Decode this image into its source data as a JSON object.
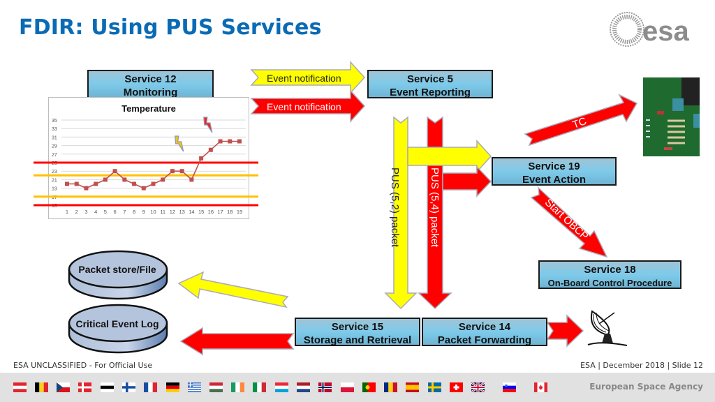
{
  "header": {
    "title": "FDIR: Using PUS Services",
    "logo_text": "esa"
  },
  "services": {
    "s12": {
      "line1": "Service 12",
      "line2": "Monitoring"
    },
    "s5": {
      "line1": "Service 5",
      "line2": "Event Reporting"
    },
    "s19": {
      "line1": "Service 19",
      "line2": "Event Action"
    },
    "s18": {
      "line1": "Service 18",
      "line2": "On-Board Control Procedure"
    },
    "s15": {
      "line1": "Service 15",
      "line2": "Storage and Retrieval"
    },
    "s14": {
      "line1": "Service 14",
      "line2": "Packet Forwarding"
    }
  },
  "arrows": {
    "event_notification_yellow": "Event notification",
    "event_notification_red": "Event notification",
    "pus_52": "PUS (5,2) packet",
    "pus_54": "PUS (5,4) packet",
    "tc": "TC",
    "start_obcp": "Start OBCP"
  },
  "stores": {
    "packet_store": "Packet store/File",
    "critical_log": "Critical Event Log"
  },
  "colors": {
    "yellow": "#ffff00",
    "red": "#ff0000",
    "title_blue": "#0a6bb5"
  },
  "chart_data": {
    "type": "line",
    "title": "Temperature",
    "x": [
      1,
      2,
      3,
      4,
      5,
      6,
      7,
      8,
      9,
      10,
      11,
      12,
      13,
      14,
      15,
      16,
      17,
      18,
      19
    ],
    "series": [
      {
        "name": "Temperature",
        "values": [
          20,
          20,
          19,
          20,
          21,
          23,
          21,
          20,
          19,
          20,
          21,
          23,
          23,
          21,
          26,
          28,
          30,
          30,
          30
        ],
        "color": "#c0504d"
      }
    ],
    "yticks": [
      15,
      17,
      19,
      21,
      23,
      25,
      27,
      29,
      31,
      33,
      35
    ],
    "ylim": [
      15,
      35
    ],
    "thresholds": [
      {
        "value": 25,
        "color": "#ff0000",
        "kind": "upper-alarm"
      },
      {
        "value": 22,
        "color": "#ffc000",
        "kind": "upper-warning"
      },
      {
        "value": 17,
        "color": "#ffc000",
        "kind": "lower-warning"
      },
      {
        "value": 15,
        "color": "#ff0000",
        "kind": "lower-alarm"
      }
    ],
    "annotations": [
      {
        "x": 13,
        "icon": "lightning-yellow"
      },
      {
        "x": 16,
        "icon": "lightning-red"
      }
    ],
    "grid": true,
    "xlabel": "",
    "ylabel": ""
  },
  "footer": {
    "classification": "ESA UNCLASSIFIED - For Official Use",
    "slide_info": "ESA |  December 2018 | Slide  12",
    "agency": "European Space Agency",
    "flags": [
      "Austria",
      "Belgium",
      "Czech Republic",
      "Denmark",
      "Estonia",
      "Finland",
      "France",
      "Germany",
      "Greece",
      "Hungary",
      "Ireland",
      "Italy",
      "Luxembourg",
      "Netherlands",
      "Norway",
      "Poland",
      "Portugal",
      "Romania",
      "Spain",
      "Sweden",
      "Switzerland",
      "United Kingdom",
      "Slovenia",
      "Canada"
    ]
  }
}
